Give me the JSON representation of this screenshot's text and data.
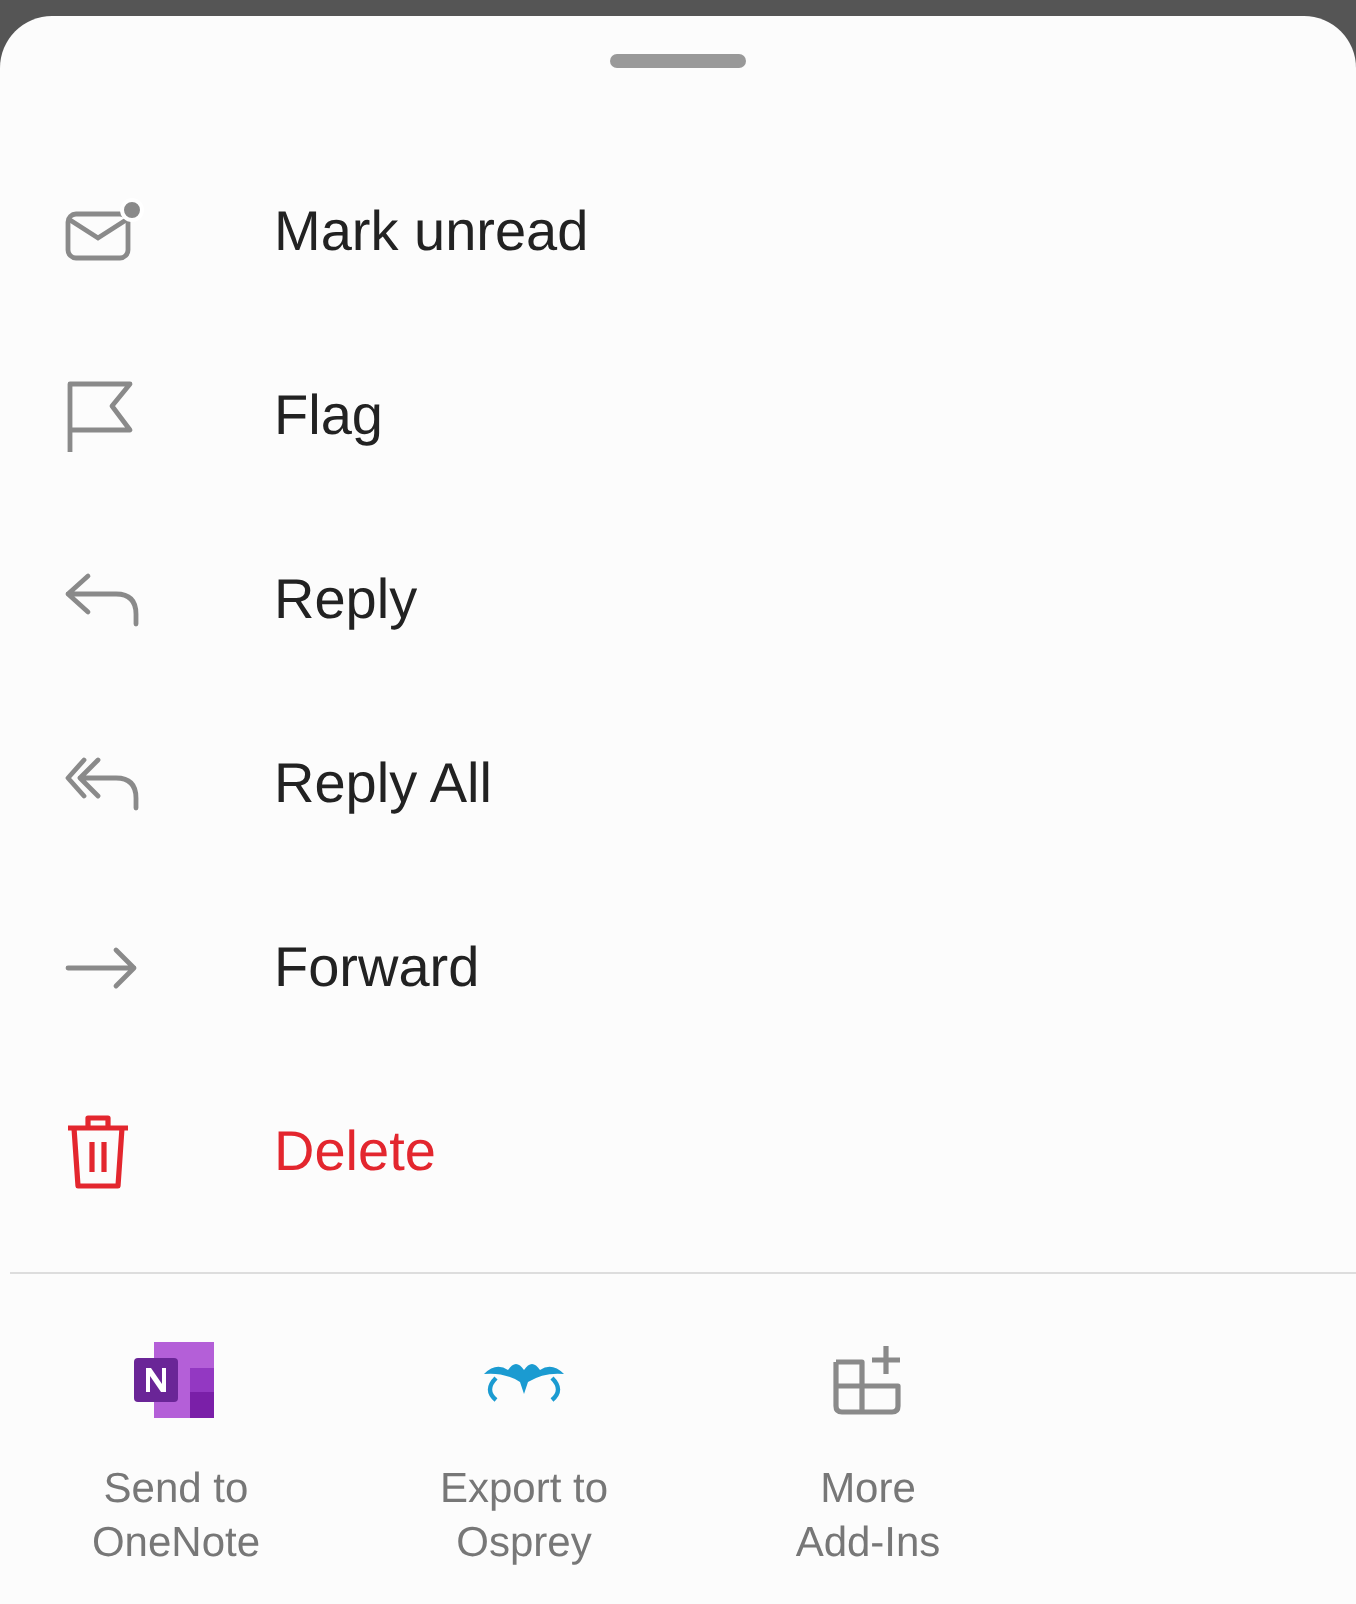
{
  "actions": [
    {
      "label": "Mark unread",
      "destructive": false
    },
    {
      "label": "Flag",
      "destructive": false
    },
    {
      "label": "Reply",
      "destructive": false
    },
    {
      "label": "Reply All",
      "destructive": false
    },
    {
      "label": "Forward",
      "destructive": false
    },
    {
      "label": "Delete",
      "destructive": true
    }
  ],
  "add_ins": [
    {
      "label": "Send to\nOneNote"
    },
    {
      "label": "Export to\nOsprey"
    },
    {
      "label": "More\nAdd-Ins"
    }
  ]
}
